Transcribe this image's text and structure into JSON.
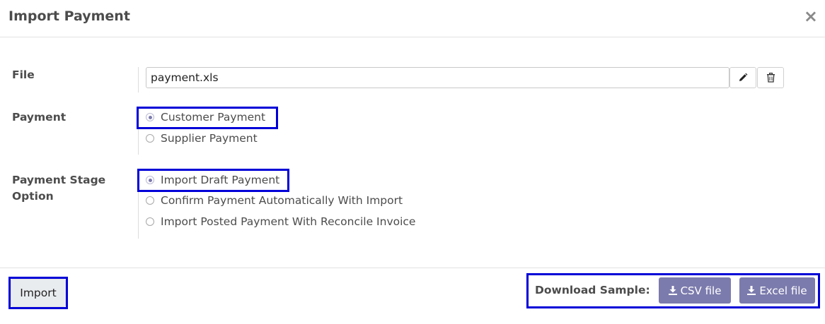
{
  "dialog": {
    "title": "Import Payment",
    "close_glyph": "×"
  },
  "form": {
    "file": {
      "label": "File",
      "value": "payment.xls",
      "edit_icon": "pencil-icon",
      "delete_icon": "trash-icon"
    },
    "payment": {
      "label": "Payment",
      "options": [
        {
          "label": "Customer Payment",
          "checked": true
        },
        {
          "label": "Supplier Payment",
          "checked": false
        }
      ]
    },
    "stage": {
      "label_line1": "Payment Stage",
      "label_line2": "Option",
      "options": [
        {
          "label": "Import Draft Payment",
          "checked": true
        },
        {
          "label": "Confirm Payment Automatically With Import",
          "checked": false
        },
        {
          "label": "Import Posted Payment With Reconcile Invoice",
          "checked": false
        }
      ]
    }
  },
  "footer": {
    "import_label": "Import",
    "download_label": "Download Sample:",
    "csv_label": "CSV file",
    "excel_label": "Excel file",
    "download_icon": "download-icon"
  },
  "colors": {
    "accent": "#7c7bad",
    "highlight": "#0000d8"
  }
}
